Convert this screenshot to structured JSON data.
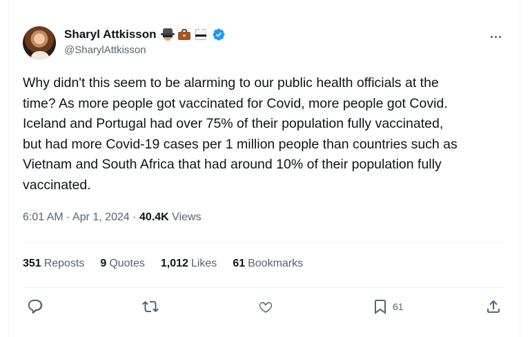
{
  "author": {
    "display_name": "Sharyl Attkisson",
    "handle": "@SharylAttkisson",
    "badges": [
      "spy-emoji",
      "briefcase-emoji",
      "martial-arts-uniform-emoji",
      "verified-badge-icon"
    ]
  },
  "tweet": {
    "text": "Why didn't this seem to be alarming to our public health officials at the\ntime? As more people got vaccinated for Covid, more people got Covid.\nIceland and Portugal had over 75% of their population fully vaccinated,\nbut had more Covid-19 cases per 1 million people than countries such as\nVietnam and South Africa that had around 10% of their population fully\nvaccinated.",
    "time": "6:01 AM",
    "separator": "·",
    "date": "Apr 1, 2024",
    "views_count": "40.4K",
    "views_label": "Views"
  },
  "stats": {
    "reposts_count": "351",
    "reposts_label": "Reposts",
    "quotes_count": "9",
    "quotes_label": "Quotes",
    "likes_count": "1,012",
    "likes_label": "Likes",
    "bookmarks_count": "61",
    "bookmarks_label": "Bookmarks"
  },
  "actions": {
    "bookmark_count": "61"
  },
  "colors": {
    "verified": "#1d9bf0",
    "secondary_text": "#536471",
    "primary_text": "#0f1419",
    "divider": "#eff3f4"
  }
}
